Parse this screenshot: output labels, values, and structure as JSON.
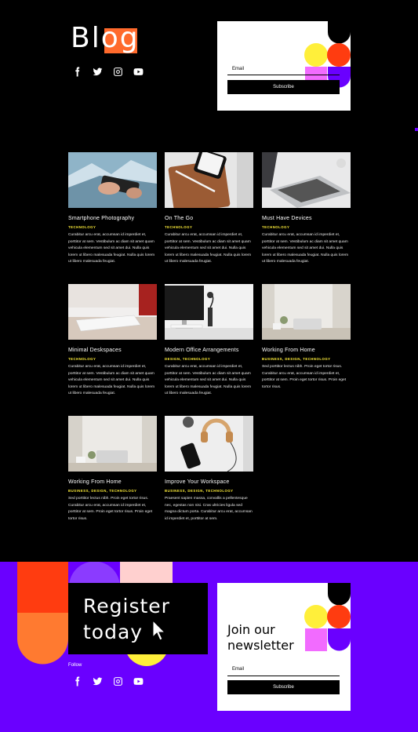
{
  "header": {
    "title": "Blog",
    "social": [
      {
        "icon": "facebook-icon"
      },
      {
        "icon": "twitter-icon"
      },
      {
        "icon": "instagram-icon"
      },
      {
        "icon": "youtube-icon"
      }
    ]
  },
  "subscribe_top": {
    "email_label": "Email",
    "button_label": "Subscribe"
  },
  "posts": [
    {
      "title": "Smartphone Photography",
      "category": "TECHNOLOGY",
      "excerpt": "Curabitur arcu erat, accumsan id imperdiet et, porttitor at sem. Vestibulum ac diam sit amet quam vehicula elementum sed sit amet dui. Nulla quis lorem ut libero malesuada feugiat. Nulla quis lorem ut libero malesuada feugiat."
    },
    {
      "title": "On The Go",
      "category": "TECHNOLOGY",
      "excerpt": "Curabitur arcu erat, accumsan id imperdiet et, porttitor at sem. Vestibulum ac diam sit amet quam vehicula elementum sed sit amet dui. Nulla quis lorem ut libero malesuada feugiat. Nulla quis lorem ut libero malesuada feugiat."
    },
    {
      "title": "Must Have Devices",
      "category": "TECHNOLOGY",
      "excerpt": "Curabitur arcu erat, accumsan id imperdiet et, porttitor at sem. Vestibulum ac diam sit amet quam vehicula elementum sed sit amet dui. Nulla quis lorem ut libero malesuada feugiat. Nulla quis lorem ut libero malesuada feugiat."
    },
    {
      "title": "Minimal Deskspaces",
      "category": "TECHNOLOGY",
      "excerpt": "Curabitur arcu erat, accumsan id imperdiet et, porttitor at sem. Vestibulum ac diam sit amet quam vehicula elementum sed sit amet dui. Nulla quis lorem ut libero malesuada feugiat. Nulla quis lorem ut libero malesuada feugiat."
    },
    {
      "title": "Modern Office Arrangements",
      "category": "DESIGN, TECHNOLOGY",
      "excerpt": "Curabitur arcu erat, accumsan id imperdiet et, porttitor at sem. Vestibulum ac diam sit amet quam vehicula elementum sed sit amet dui. Nulla quis lorem ut libero malesuada feugiat. Nulla quis lorem ut libero malesuada feugiat."
    },
    {
      "title": "Working From Home",
      "category": "BUSINESS, DESIGN, TECHNOLOGY",
      "excerpt": "Sed porttitor lectus nibh. Proin eget tortor risus. Curabitur arcu erat, accumsan id imperdiet et, porttitor at sem. Proin eget tortor risus. Proin eget tortor risus."
    },
    {
      "title": "Working From Home",
      "category": "BUSINESS, DESIGN, TECHNOLOGY",
      "excerpt": "Sed porttitor lectus nibh. Proin eget tortor risus. Curabitur arcu erat, accumsan id imperdiet et, porttitor at sem. Proin eget tortor risus. Proin eget tortor risus."
    },
    {
      "title": "Improve Your Workspace",
      "category": "BUSINESS, DESIGN, TECHNOLOGY",
      "excerpt": "Praesent sapien massa, convallis a pellentesque nec, egestas non nisi. Cras ultricies ligula sed magna dictum porta. Curabitur arcu erat, accumsan id imperdiet et, porttitor at sem."
    }
  ],
  "footer": {
    "register_line1": "Register",
    "register_line2": "today",
    "follow_label": "Follow",
    "newsletter_line1": "Join our",
    "newsletter_line2": "newsletter",
    "email_label": "Email",
    "button_label": "Subscribe"
  },
  "colors": {
    "accent_purple": "#6a00ff",
    "accent_orange": "#ff6a2c",
    "accent_red": "#ff3c10",
    "accent_yellow": "#ffef3a",
    "accent_pink": "#f26bff"
  }
}
